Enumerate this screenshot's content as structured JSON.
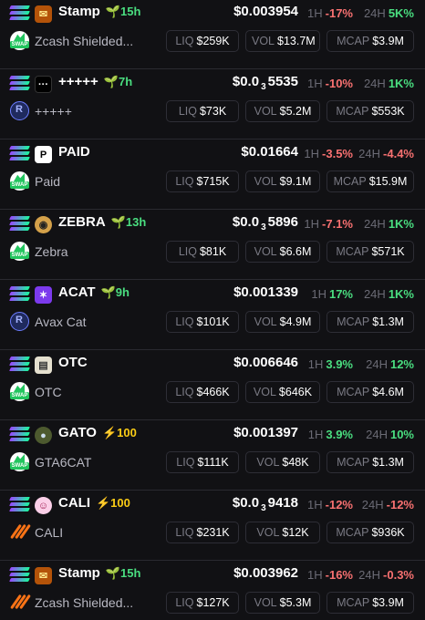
{
  "labels": {
    "liq": "LIQ",
    "vol": "VOL",
    "mcap": "MCAP",
    "h1": "1H",
    "h24": "24H"
  },
  "colors": {
    "positive": "#4ade80",
    "negative": "#f87171",
    "boost": "#facc15",
    "background": "#111114"
  },
  "tokens": [
    {
      "chain_icon": "solana-icon",
      "thumb_icon": "stamp-icon",
      "dex_icon": "swap-icon",
      "symbol": "Stamp",
      "age": "🌱15h",
      "boost": "",
      "name": "Zcash Shielded...",
      "price_main": "$0.003954",
      "price_zeros": "",
      "price_tail": "",
      "change_1h": "-17%",
      "change_1h_dir": "neg",
      "change_24h": "5K%",
      "change_24h_dir": "pos",
      "liq": "$259K",
      "vol": "$13.7M",
      "mcap": "$3.9M"
    },
    {
      "chain_icon": "solana-icon",
      "thumb_icon": "dots-icon",
      "dex_icon": "raydium-icon",
      "symbol": "+++++",
      "age": "🌱7h",
      "boost": "",
      "name": "+++++",
      "price_main": "$0.0",
      "price_zeros": "3",
      "price_tail": "5535",
      "change_1h": "-10%",
      "change_1h_dir": "neg",
      "change_24h": "1K%",
      "change_24h_dir": "pos",
      "liq": "$73K",
      "vol": "$5.2M",
      "mcap": "$553K"
    },
    {
      "chain_icon": "solana-icon",
      "thumb_icon": "paid-logo-icon",
      "dex_icon": "swap-icon",
      "symbol": "PAID",
      "age": "",
      "boost": "",
      "name": "Paid",
      "price_main": "$0.01664",
      "price_zeros": "",
      "price_tail": "",
      "change_1h": "-3.5%",
      "change_1h_dir": "neg",
      "change_24h": "-4.4%",
      "change_24h_dir": "neg",
      "liq": "$715K",
      "vol": "$9.1M",
      "mcap": "$15.9M"
    },
    {
      "chain_icon": "solana-icon",
      "thumb_icon": "zebra-icon",
      "dex_icon": "swap-icon",
      "symbol": "ZEBRA",
      "age": "🌱13h",
      "boost": "",
      "name": "Zebra",
      "price_main": "$0.0",
      "price_zeros": "3",
      "price_tail": "5896",
      "change_1h": "-7.1%",
      "change_1h_dir": "neg",
      "change_24h": "1K%",
      "change_24h_dir": "pos",
      "liq": "$81K",
      "vol": "$6.6M",
      "mcap": "$571K"
    },
    {
      "chain_icon": "solana-icon",
      "thumb_icon": "avax-cat-icon",
      "dex_icon": "raydium-icon",
      "symbol": "ACAT",
      "age": "🌱9h",
      "boost": "",
      "name": "Avax Cat",
      "price_main": "$0.001339",
      "price_zeros": "",
      "price_tail": "",
      "change_1h": "17%",
      "change_1h_dir": "pos",
      "change_24h": "1K%",
      "change_24h_dir": "pos",
      "liq": "$101K",
      "vol": "$4.9M",
      "mcap": "$1.3M"
    },
    {
      "chain_icon": "solana-icon",
      "thumb_icon": "otc-icon",
      "dex_icon": "swap-icon",
      "symbol": "OTC",
      "age": "",
      "boost": "",
      "name": "OTC",
      "price_main": "$0.006646",
      "price_zeros": "",
      "price_tail": "",
      "change_1h": "3.9%",
      "change_1h_dir": "pos",
      "change_24h": "12%",
      "change_24h_dir": "pos",
      "liq": "$466K",
      "vol": "$646K",
      "mcap": "$4.6M"
    },
    {
      "chain_icon": "solana-icon",
      "thumb_icon": "gato-icon",
      "dex_icon": "swap-icon",
      "symbol": "GATO",
      "age": "",
      "boost": "⚡100",
      "name": "GTA6CAT",
      "price_main": "$0.001397",
      "price_zeros": "",
      "price_tail": "",
      "change_1h": "3.9%",
      "change_1h_dir": "pos",
      "change_24h": "10%",
      "change_24h_dir": "pos",
      "liq": "$111K",
      "vol": "$48K",
      "mcap": "$1.3M"
    },
    {
      "chain_icon": "solana-icon",
      "thumb_icon": "cali-icon",
      "dex_icon": "pump-icon",
      "symbol": "CALI",
      "age": "",
      "boost": "⚡100",
      "name": "CALI",
      "price_main": "$0.0",
      "price_zeros": "3",
      "price_tail": "9418",
      "change_1h": "-12%",
      "change_1h_dir": "neg",
      "change_24h": "-12%",
      "change_24h_dir": "neg",
      "liq": "$231K",
      "vol": "$12K",
      "mcap": "$936K"
    },
    {
      "chain_icon": "solana-icon",
      "thumb_icon": "stamp-icon",
      "dex_icon": "pump-icon",
      "symbol": "Stamp",
      "age": "🌱15h",
      "boost": "",
      "name": "Zcash Shielded...",
      "price_main": "$0.003962",
      "price_zeros": "",
      "price_tail": "",
      "change_1h": "-16%",
      "change_1h_dir": "neg",
      "change_24h": "-0.3%",
      "change_24h_dir": "neg",
      "liq": "$127K",
      "vol": "$5.3M",
      "mcap": "$3.9M"
    }
  ]
}
